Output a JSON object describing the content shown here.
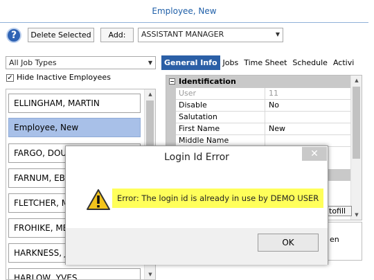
{
  "window": {
    "title": "Employee, New"
  },
  "toolbar": {
    "help_icon": "question-icon",
    "delete_label": "Delete Selected",
    "add_label": "Add:",
    "add_selected": "ASSISTANT MANAGER"
  },
  "filter": {
    "job_type_selected": "All Job Types",
    "hide_inactive_label": "Hide Inactive Employees",
    "hide_inactive_checked": "✓"
  },
  "employees": [
    "ELLINGHAM, MARTIN",
    "Employee, New",
    "FARGO, DOUG",
    "FARNUM, EB",
    "FLETCHER, MOSS",
    "FROHIKE, MELVIN",
    "HARKNESS, JACK",
    "HARLOW, YVES"
  ],
  "tabs": [
    "General Info",
    "Jobs",
    "Time Sheet",
    "Schedule",
    "Activi"
  ],
  "properties": {
    "category": "Identification",
    "rows": [
      {
        "key": "User",
        "value": "11"
      },
      {
        "key": "Disable",
        "value": "No"
      },
      {
        "key": "Salutation",
        "value": ""
      },
      {
        "key": "First Name",
        "value": "New"
      },
      {
        "key": "Middle Name",
        "value": ""
      }
    ]
  },
  "background_partial": {
    "autofill_label": "tofill",
    "lower_text": "en"
  },
  "dialog": {
    "title": "Login Id Error",
    "close_glyph": "✕",
    "message": "Error: The login id is already in use by DEMO USER",
    "ok_label": "OK",
    "icon": "warning-icon"
  }
}
